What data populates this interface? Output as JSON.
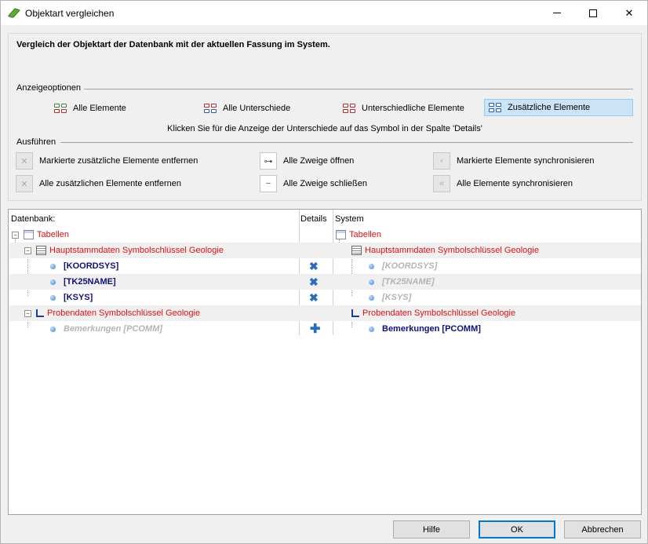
{
  "window": {
    "title": "Objektart vergleichen",
    "minimize": "—",
    "maximize": "☐",
    "close": "✕"
  },
  "header": {
    "headline": "Vergleich der Objektart der Datenbank mit der aktuellen Fassung im System."
  },
  "display_options": {
    "label": "Anzeigeoptionen",
    "options": [
      {
        "label": "Alle Elemente",
        "icon": "all-elements-icon",
        "colors": [
          "#2e8b3a",
          "#c0282c"
        ]
      },
      {
        "label": "Alle Unterschiede",
        "icon": "all-differences-icon",
        "colors": [
          "#c0282c",
          "#2a5db0"
        ]
      },
      {
        "label": "Unterschiedliche Elemente",
        "icon": "different-elements-icon",
        "colors": [
          "#c0282c",
          "#c0282c"
        ]
      },
      {
        "label": "Zusätzliche Elemente",
        "icon": "additional-elements-icon",
        "colors": [
          "#2a5db0",
          "#2a5db0"
        ],
        "selected": true
      }
    ],
    "hint": "Klicken Sie für die Anzeige der Unterschiede auf das Symbol in der Spalte 'Details'"
  },
  "actions": {
    "label": "Ausführen",
    "items": [
      {
        "label": "Markierte zusätzliche Elemente entfernen",
        "icon": "remove-marked-icon"
      },
      {
        "label": "Alle Zweige öffnen",
        "icon": "expand-all-icon"
      },
      {
        "label": "Markierte Elemente synchronisieren",
        "icon": "sync-marked-icon"
      },
      {
        "label": "Alle zusätzlichen Elemente entfernen",
        "icon": "remove-all-icon"
      },
      {
        "label": "Alle Zweige schließen",
        "icon": "collapse-all-icon"
      },
      {
        "label": "Alle Elemente synchronisieren",
        "icon": "sync-all-icon"
      }
    ]
  },
  "tree": {
    "columns": {
      "database": "Datenbank:",
      "details": "Details",
      "system": "System"
    },
    "rows": [
      {
        "db": "Tabellen",
        "db_style": "red",
        "db_icon": "table-icon",
        "details": "",
        "sys": "Tabellen",
        "sys_style": "red",
        "sys_icon": "table-icon"
      },
      {
        "db": "Hauptstammdaten Symbolschlüssel Geologie",
        "db_style": "red",
        "db_icon": "document-icon",
        "details": "",
        "sys": "Hauptstammdaten Symbolschlüssel Geologie",
        "sys_style": "red",
        "sys_icon": "document-icon"
      },
      {
        "db": "[KOORDSYS]",
        "db_style": "navy",
        "db_icon": "field-icon",
        "details": "✖",
        "details_icon": "remove-icon",
        "sys": "[KOORDSYS]",
        "sys_style": "grey",
        "sys_icon": "field-icon"
      },
      {
        "db": "[TK25NAME]",
        "db_style": "navy",
        "db_icon": "field-icon",
        "details": "✖",
        "details_icon": "remove-icon",
        "sys": "[TK25NAME]",
        "sys_style": "grey",
        "sys_icon": "field-icon"
      },
      {
        "db": "[KSYS]",
        "db_style": "navy",
        "db_icon": "field-icon",
        "details": "✖",
        "details_icon": "remove-icon",
        "sys": "[KSYS]",
        "sys_style": "grey",
        "sys_icon": "field-icon"
      },
      {
        "db": "Probendaten Symbolschlüssel Geologie",
        "db_style": "red",
        "db_icon": "profile-icon",
        "details": "",
        "sys": "Probendaten Symbolschlüssel Geologie",
        "sys_style": "red",
        "sys_icon": "profile-icon"
      },
      {
        "db": "Bemerkungen [PCOMM]",
        "db_style": "grey",
        "db_icon": "field-icon",
        "details": "✚",
        "details_icon": "add-icon",
        "sys": "Bemerkungen [PCOMM]",
        "sys_style": "navy",
        "sys_icon": "field-icon"
      }
    ]
  },
  "buttons": {
    "help": "Hilfe",
    "ok": "OK",
    "cancel": "Abbrechen"
  }
}
